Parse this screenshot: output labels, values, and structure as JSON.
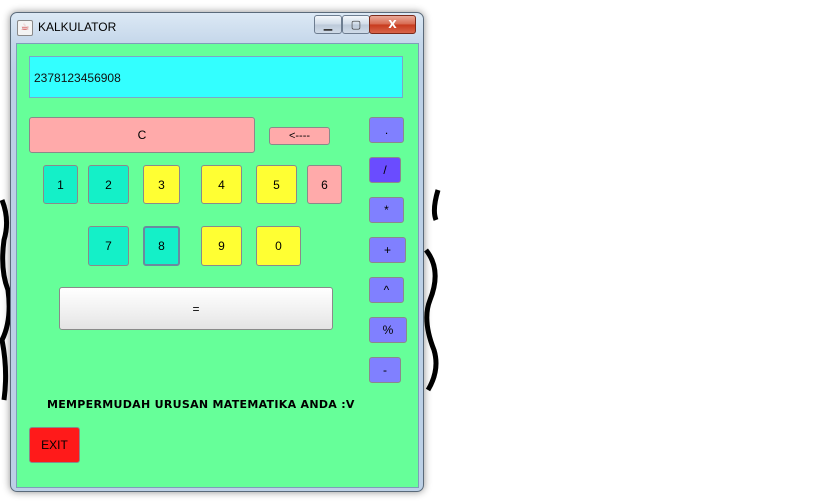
{
  "window": {
    "title": "KALKULATOR",
    "minimize": "▁",
    "maximize": "▢",
    "close": "X"
  },
  "display": {
    "value": "2378123456908"
  },
  "buttons": {
    "clear": "C",
    "backspace": "<----",
    "digits_row1": [
      "1",
      "2",
      "3",
      "4",
      "5",
      "6"
    ],
    "digits_row2": [
      "7",
      "8",
      "9",
      "0"
    ],
    "equals": "=",
    "exit": "EXIT",
    "operators": [
      ".",
      "/",
      "*",
      "+",
      "^",
      "%",
      "-"
    ]
  },
  "tagline": "MEMPERMUDAH URUSAN MATEMATIKA ANDA :V",
  "colors": {
    "background": "#66ff99",
    "display": "#33ffff",
    "exit": "#ff1a1a"
  }
}
